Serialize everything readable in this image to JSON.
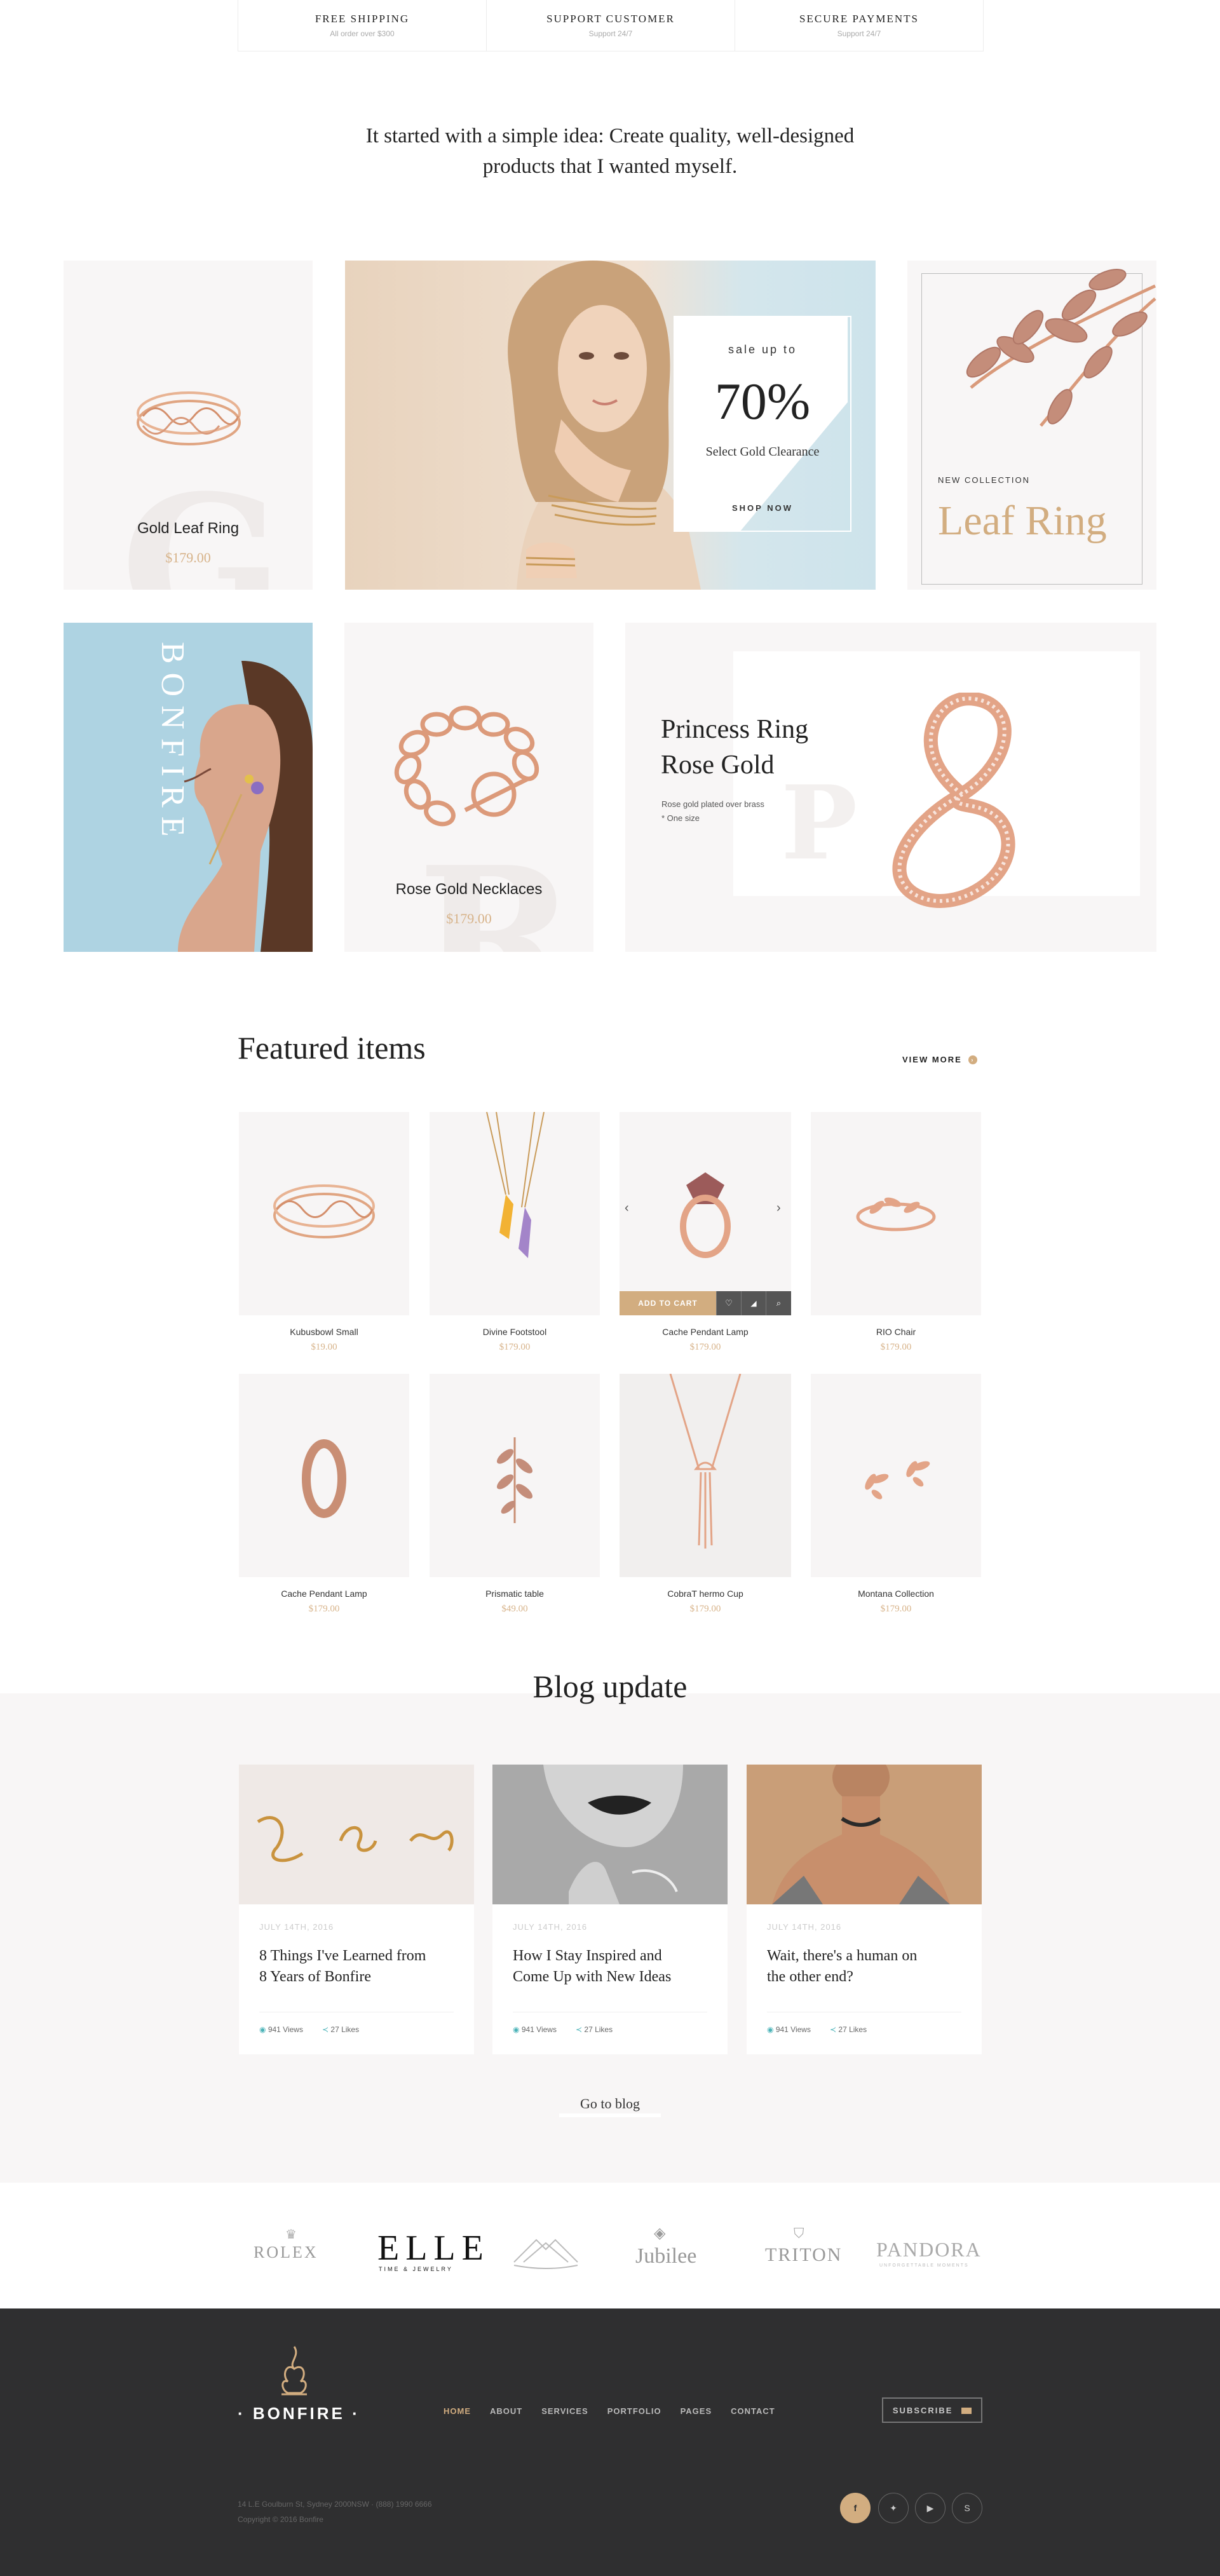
{
  "features": [
    {
      "title": "FREE SHIPPING",
      "sub": "All order over $300"
    },
    {
      "title": "SUPPORT CUSTOMER",
      "sub": "Support 24/7"
    },
    {
      "title": "SECURE PAYMENTS",
      "sub": "Support 24/7"
    }
  ],
  "intro": {
    "line1": "It started with a simple idea: Create quality, well-designed",
    "line2": "products that I wanted myself."
  },
  "promo": {
    "gold_leaf": {
      "name": "Gold Leaf Ring",
      "price": "$179.00",
      "letter": "G"
    },
    "sale": {
      "small": "sale up to",
      "big": "70%",
      "sub": "Select Gold Clearance",
      "cta": "SHOP NOW"
    },
    "leaf_ring": {
      "eyebrow": "NEW COLLECTION",
      "title": "Leaf Ring"
    },
    "bonfire_vertical": "BONFIRE",
    "necklace": {
      "name": "Rose Gold Necklaces",
      "price": "$179.00",
      "letter": "R"
    },
    "princess": {
      "title1": "Princess Ring",
      "title2": "Rose Gold",
      "desc1": "Rose gold plated over brass",
      "desc2": "* One size",
      "letter": "P"
    }
  },
  "featured": {
    "title": "Featured items",
    "view_more": "VIEW MORE",
    "add_to_cart": "ADD TO CART",
    "items": [
      {
        "name": "Kubusbowl Small",
        "price": "$19.00"
      },
      {
        "name": "Divine Footstool",
        "price": "$179.00"
      },
      {
        "name": "Cache Pendant Lamp",
        "price": "$179.00"
      },
      {
        "name": "RIO Chair",
        "price": "$179.00"
      },
      {
        "name": "Cache Pendant Lamp",
        "price": "$179.00"
      },
      {
        "name": "Prismatic table",
        "price": "$49.00"
      },
      {
        "name": "CobraT hermo Cup",
        "price": "$179.00"
      },
      {
        "name": "Montana Collection",
        "price": "$179.00"
      }
    ]
  },
  "blog": {
    "title": "Blog update",
    "cta": "Go to blog",
    "posts": [
      {
        "date": "JULY 14TH, 2016",
        "title1": "8 Things I've Learned from",
        "title2": "8 Years of Bonfire",
        "views": "941 Views",
        "likes": "27 Likes"
      },
      {
        "date": "JULY 14TH, 2016",
        "title1": "How I Stay Inspired and",
        "title2": "Come Up with New Ideas",
        "views": "941 Views",
        "likes": "27 Likes"
      },
      {
        "date": "JULY 14TH, 2016",
        "title1": "Wait, there's a human on",
        "title2": "the other end?",
        "views": "941 Views",
        "likes": "27 Likes"
      }
    ]
  },
  "brands": {
    "rolex": "ROLEX",
    "elle": "ELLE",
    "elle_sub": "TIME & JEWELRY",
    "jubilee": "Jubilee",
    "triton": "TRITON",
    "pandora": "PANDORA",
    "pandora_sub": "UNFORGETTABLE MOMENTS"
  },
  "footer": {
    "logo": "· BONFIRE ·",
    "nav": [
      "HOME",
      "ABOUT",
      "SERVICES",
      "PORTFOLIO",
      "PAGES",
      "CONTACT"
    ],
    "subscribe": "SUBSCRIBE",
    "address": "14 L.E Goulburn St, Sydney 2000NSW  ·  (888) 1990 6666",
    "copyright": "Copyright © 2016 Bonfire",
    "active_color": "#d2ad80"
  },
  "colors": {
    "accent": "#d2ad80",
    "footer_bg": "#2f2f30",
    "card_bg": "#f8f6f6",
    "sky": "#aed3e2"
  }
}
